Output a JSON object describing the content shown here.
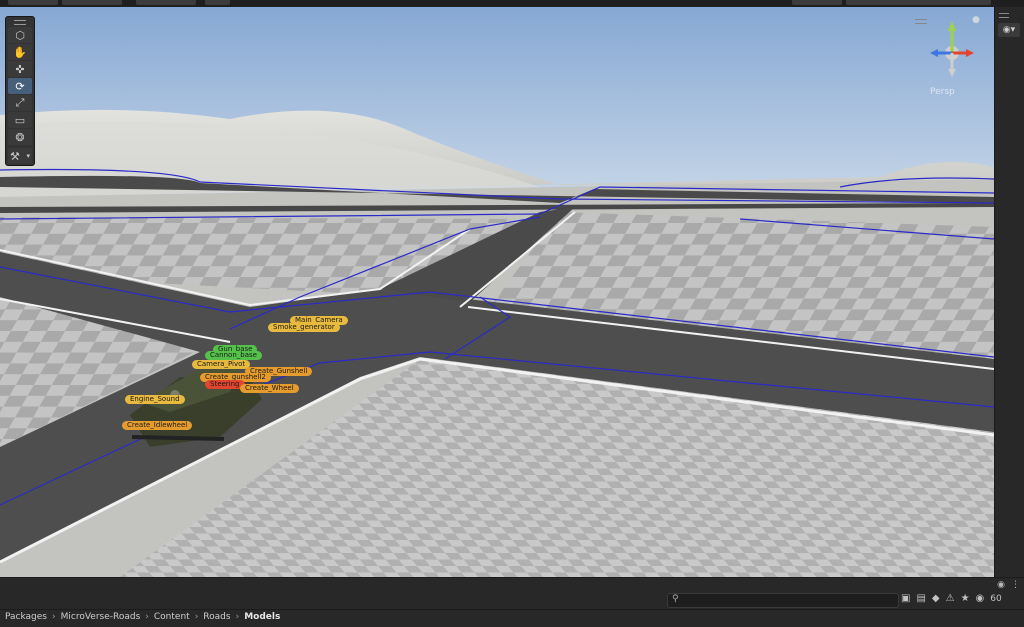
{
  "window": {
    "top_buttons": [
      "toolbar-button-1",
      "toolbar-button-2",
      "toolbar-button-3",
      "toolbar-button-4",
      "layers-button",
      "layout-button"
    ]
  },
  "toolbox": {
    "tools": [
      {
        "name": "tool-view-cube",
        "icon": "⬡",
        "active": false
      },
      {
        "name": "tool-hand",
        "icon": "✋",
        "active": false
      },
      {
        "name": "tool-move",
        "icon": "✜",
        "active": false
      },
      {
        "name": "tool-rotate",
        "icon": "⟳",
        "active": true
      },
      {
        "name": "tool-scale",
        "icon": "⤢",
        "active": false
      },
      {
        "name": "tool-rect",
        "icon": "▭",
        "active": false
      },
      {
        "name": "tool-transform",
        "icon": "❂",
        "active": false
      }
    ],
    "custom_tool_icon": "⚒",
    "dropdown_icon": "▾"
  },
  "gizmo": {
    "lock_icon": "🔒",
    "persp_label": "Persp",
    "axes": {
      "x_color": "#e2452f",
      "y_color": "#9fd24a",
      "z_color": "#3c76e0"
    }
  },
  "gizmo_persp": "Persp",
  "scene_labels": {
    "main_camera": "Main_Camera",
    "smoke_generator": "Smoke_generator",
    "gun_base": "Gun_base",
    "cannon_base": "Cannon_base",
    "camera_pivot": "Camera_Pivot",
    "create_gunshell": "Create_Gunshell",
    "create_gunshell2": "Create_gunshell2",
    "steering": "Steering",
    "engine_sound": "Engine_Sound",
    "create_idlewheel": "Create_Idlewheel",
    "create_wheel": "Create_Wheel"
  },
  "colors": {
    "road_line": "#2a2ac8",
    "orange_chip": "#e59c2c",
    "green_chip": "#54c24a",
    "red_chip": "#e2452f"
  },
  "search": {
    "placeholder": ""
  },
  "project_icons": {
    "zoom_value": "60"
  },
  "breadcrumb": [
    "Packages",
    "MicroVerse-Roads",
    "Content",
    "Roads",
    "Models"
  ]
}
